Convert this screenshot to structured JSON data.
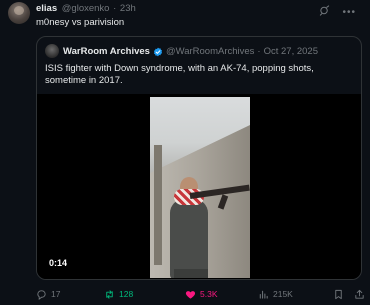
{
  "author": {
    "name": "elias",
    "handle": "@gloxenko",
    "separator": "·",
    "time": "23h"
  },
  "tweet": {
    "text": "m0nesy vs parivision"
  },
  "quote": {
    "name": "WarRoom Archives",
    "handle": "@WarRoomArchives",
    "separator": "·",
    "date": "Oct 27, 2025",
    "text": "ISIS fighter with Down syndrome, with an AK-74, popping shots, sometime in 2017.",
    "video_time": "0:14"
  },
  "actions": {
    "replies": "17",
    "reposts": "128",
    "likes": "5.3K",
    "views": "215K"
  },
  "colors": {
    "background": "#0c1016",
    "text": "#e7e9ea",
    "muted": "#71767b",
    "repost_active": "#00ba7c",
    "like_active": "#f91880",
    "verified": "#1d9bf0",
    "border": "#2f3336"
  },
  "icons": [
    "grok-icon",
    "more-icon",
    "verified-icon",
    "reply-icon",
    "repost-icon",
    "like-icon",
    "views-icon",
    "bookmark-icon",
    "share-icon"
  ]
}
